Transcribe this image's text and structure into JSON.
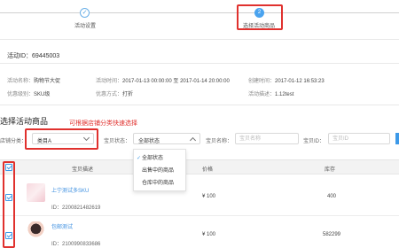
{
  "steps": [
    {
      "label": "活动设置",
      "icon": "check-icon",
      "mark": "✓"
    },
    {
      "label": "选择活动商品",
      "icon": "step-2-icon",
      "mark": "2"
    }
  ],
  "activity": {
    "id_label": "活动ID：",
    "id_value": "69445003",
    "name_label": "活动名称：",
    "name_value": "购物节大促",
    "time_label": "活动时间：",
    "time_value": "2017-01-13 00:00:00 至 2017-01-14 20:00:00",
    "created_label": "创建时间：",
    "created_value": "2017-01-12 16:53:23",
    "level_label": "优惠级别：",
    "level_value": "SKU级",
    "method_label": "优惠方式：",
    "method_value": "打折",
    "desc_label": "活动描述：",
    "desc_value": "1.12test"
  },
  "section": {
    "title": "选择活动商品",
    "note": "可根据店铺分类快速选择"
  },
  "filters": {
    "category_label": "店铺分类：",
    "category_value": "类目A",
    "status_label": "宝贝状态：",
    "status_value": "全部状态",
    "name_label": "宝贝名称：",
    "name_placeholder": "宝贝名称",
    "id_label": "宝贝ID：",
    "id_placeholder": "宝贝ID"
  },
  "status_options": [
    {
      "label": "全部状态",
      "selected": true
    },
    {
      "label": "出售中的商品",
      "selected": false
    },
    {
      "label": "仓库中的商品",
      "selected": false
    }
  ],
  "table": {
    "headers": {
      "desc": "宝贝描述",
      "price": "价格",
      "stock": "库存"
    },
    "rows": [
      {
        "name": "上宁测试多SKU",
        "id": "ID：2200821482619",
        "price": "¥ 100",
        "stock": "400",
        "checked": true
      },
      {
        "name": "包邮测试",
        "id": "ID：2100990833686",
        "price": "¥ 100",
        "stock": "582299",
        "checked": true
      }
    ]
  },
  "colors": {
    "accent": "#3d99e8",
    "highlight": "#e0312e"
  }
}
